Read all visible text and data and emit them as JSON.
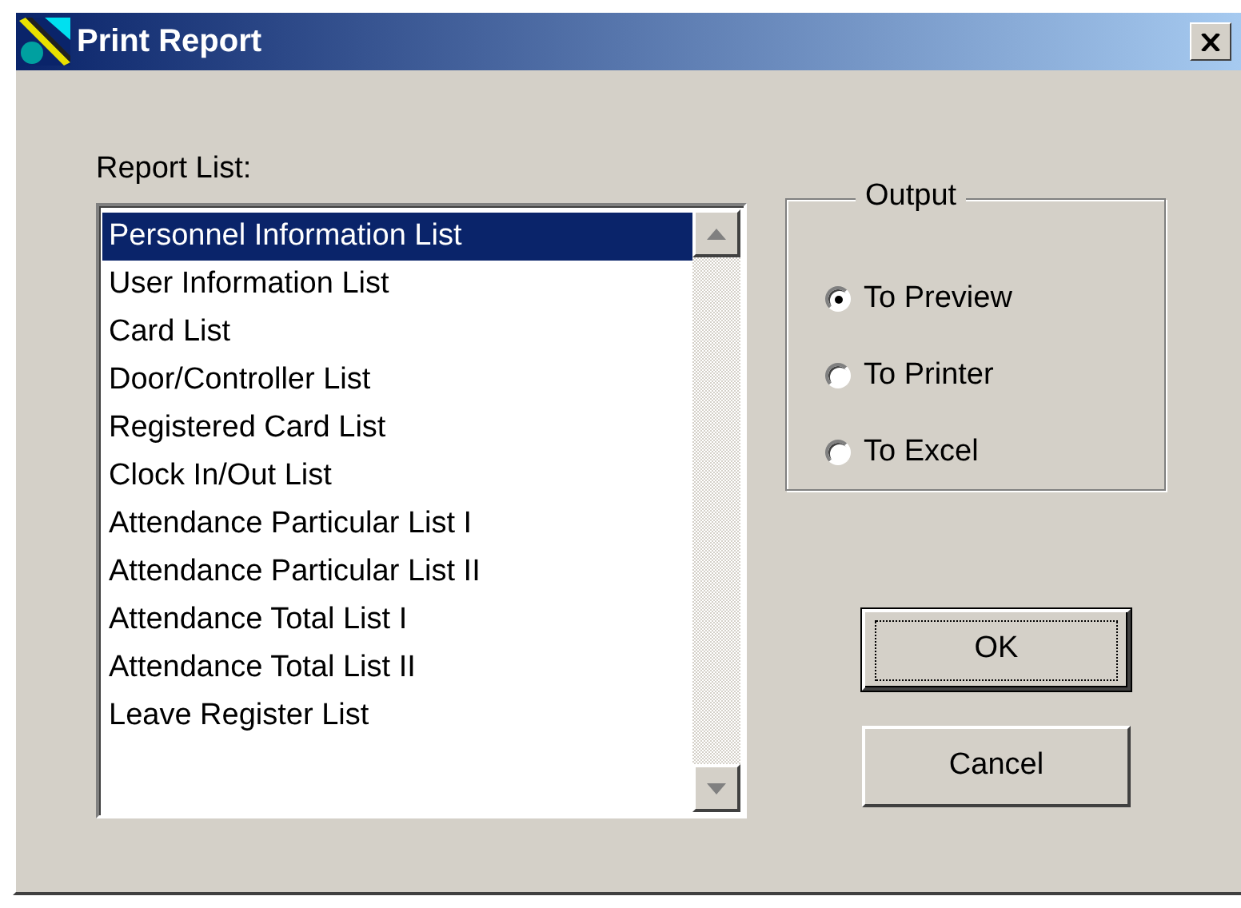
{
  "window": {
    "title": "Print Report"
  },
  "report_list": {
    "label": "Report List:",
    "items": [
      {
        "label": "Personnel Information List",
        "selected": true
      },
      {
        "label": "User Information List",
        "selected": false
      },
      {
        "label": "Card List",
        "selected": false
      },
      {
        "label": "Door/Controller List",
        "selected": false
      },
      {
        "label": "Registered Card List",
        "selected": false
      },
      {
        "label": "Clock In/Out List",
        "selected": false
      },
      {
        "label": "Attendance Particular List I",
        "selected": false
      },
      {
        "label": "Attendance Particular List II",
        "selected": false
      },
      {
        "label": "Attendance Total List I",
        "selected": false
      },
      {
        "label": "Attendance Total List II",
        "selected": false
      },
      {
        "label": "Leave Register List",
        "selected": false
      }
    ]
  },
  "output": {
    "title": "Output",
    "options": [
      {
        "label": "To Preview",
        "selected": true
      },
      {
        "label": "To Printer",
        "selected": false
      },
      {
        "label": "To Excel",
        "selected": false
      }
    ]
  },
  "buttons": [
    {
      "label": "OK",
      "default": true
    },
    {
      "label": "Cancel",
      "default": false
    }
  ]
}
